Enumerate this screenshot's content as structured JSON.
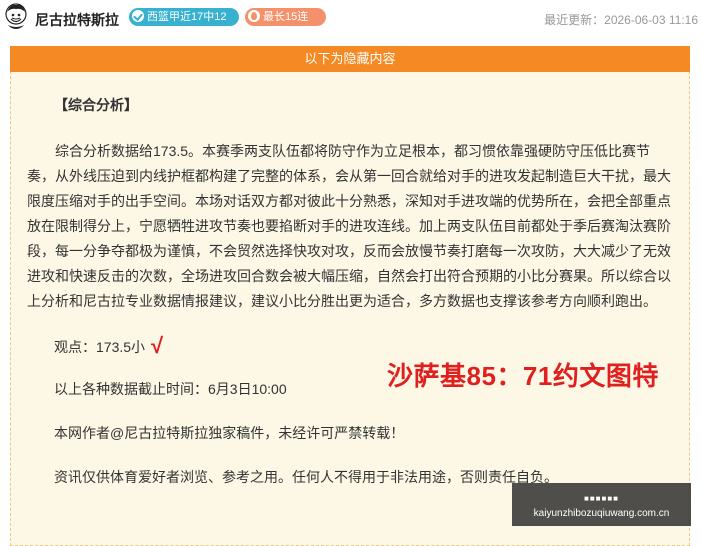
{
  "header": {
    "author": "尼古拉特斯拉",
    "badge_recent": "西篮甲近17中12",
    "badge_streak": "最长15连红",
    "updated": "最近更新：2026-06-03 11:16"
  },
  "colors": {
    "banner": "#f58a24",
    "card_bg": "#fdf7e6",
    "badge_blue": "#38b1cf",
    "badge_orange": "#f5916a",
    "highlight_red": "#e0201f"
  },
  "icons": {
    "avatar": "author-avatar",
    "badge_recent": "check-icon",
    "badge_streak": "flame-icon"
  },
  "article": {
    "banner": "以下为隐藏内容",
    "section_title": "【综合分析】",
    "analysis": "综合分析数据给173.5。本赛季两支队伍都将防守作为立足根本，都习惯依靠强硬防守压低比赛节奏，从外线压迫到内线护框都构建了完整的体系，会从第一回合就给对手的进攻发起制造巨大干扰，最大限度压缩对手的出手空间。本场对话双方都对彼此十分熟悉，深知对手进攻端的优势所在，会把全部重点放在限制得分上，宁愿牺牲进攻节奏也要掐断对手的进攻连线。加上两支队伍目前都处于季后赛淘汰赛阶段，每一分争夺都极为谨慎，不会贸然选择快攻对攻，反而会放慢节奏打磨每一次攻防，大大减少了无效进攻和快速反击的次数，全场进攻回合数会被大幅压缩，自然会打出符合预期的小比分赛果。所以综合以上分析和尼古拉专业数据情报建议，建议小比分胜出更为适合，多方数据也支撑该参考方向顺利跑出。",
    "viewpoint": "观点：173.5小",
    "check_mark": "√",
    "score_overlay": "沙萨基85：71约文图特",
    "cutoff": "以上各种数据截止时间：6月3日10:00",
    "copyright": "本网作者@尼古拉特斯拉独家稿件，未经许可严禁转载！",
    "disclaimer": "资讯仅供体育爱好者浏览、参考之用。任何人不得用于非法用途，否则责任自负。"
  },
  "watermark": {
    "top": "■■■■■■",
    "url": "kaiyunzhibozuqiuwang.com.cn"
  }
}
